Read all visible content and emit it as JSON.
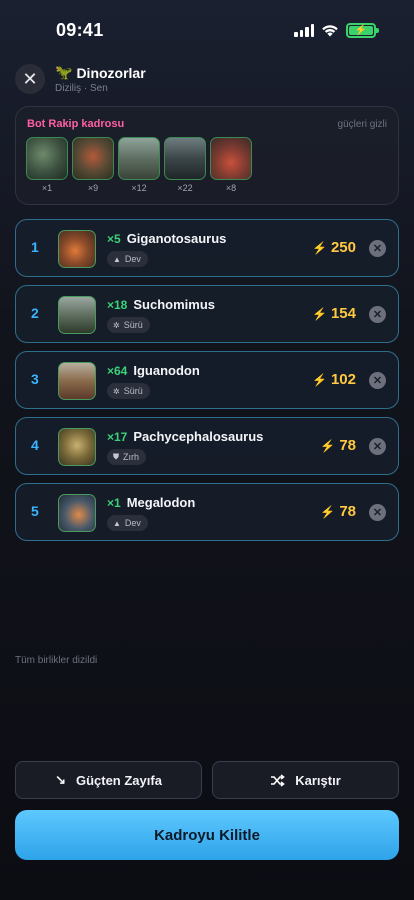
{
  "status_bar": {
    "time": "09:41"
  },
  "header": {
    "emoji": "🦖",
    "title": "Dinozorlar",
    "subtitle": "Diziliş · Sen"
  },
  "bot": {
    "title": "Bot Rakip kadrosu",
    "hidden_note": "güçleri gizli",
    "units": [
      {
        "count": "×1"
      },
      {
        "count": "×9"
      },
      {
        "count": "×12"
      },
      {
        "count": "×22"
      },
      {
        "count": "×8"
      }
    ]
  },
  "roster": [
    {
      "rank": "1",
      "count": "×5",
      "name": "Giganotosaurus",
      "tag": "Dev",
      "tag_icon": "bell-icon",
      "power": "250"
    },
    {
      "rank": "2",
      "count": "×18",
      "name": "Suchomimus",
      "tag": "Sürü",
      "tag_icon": "swarm-icon",
      "power": "154"
    },
    {
      "rank": "3",
      "count": "×64",
      "name": "Iguanodon",
      "tag": "Sürü",
      "tag_icon": "swarm-icon",
      "power": "102"
    },
    {
      "rank": "4",
      "count": "×17",
      "name": "Pachycephalosaurus",
      "tag": "Zırh",
      "tag_icon": "shield-icon",
      "power": "78"
    },
    {
      "rank": "5",
      "count": "×1",
      "name": "Megalodon",
      "tag": "Dev",
      "tag_icon": "bell-icon",
      "power": "78"
    }
  ],
  "status_text": "Tüm birlikler dizildi",
  "buttons": {
    "sort": "Güçten Zayıfa",
    "shuffle": "Karıştır",
    "lock": "Kadroyu Kilitle"
  },
  "colors": {
    "accent": "#3bb4ff",
    "power": "#ffc940",
    "count": "#3ad37a",
    "bot_title": "#ff5fa7"
  }
}
